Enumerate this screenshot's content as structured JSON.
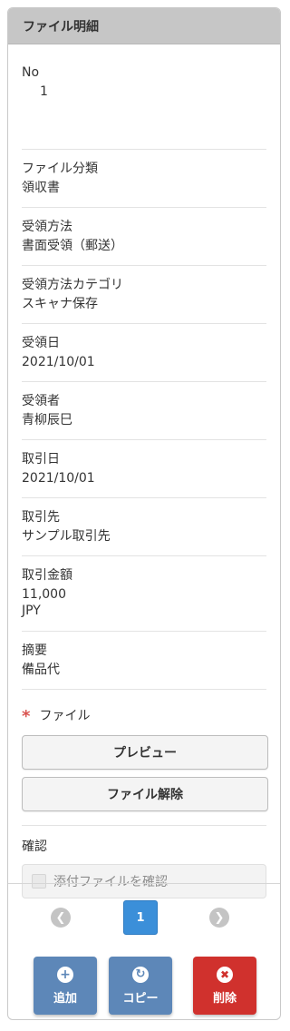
{
  "header": {
    "title": "ファイル明細"
  },
  "fields": {
    "no": {
      "label": "No",
      "value": "1"
    },
    "category": {
      "label": "ファイル分類",
      "value": "領収書"
    },
    "method": {
      "label": "受領方法",
      "value": "書面受領（郵送）"
    },
    "method_category": {
      "label": "受領方法カテゴリ",
      "value": "スキャナ保存"
    },
    "received_date": {
      "label": "受領日",
      "value": "2021/10/01"
    },
    "receiver": {
      "label": "受領者",
      "value": "青柳辰巳"
    },
    "transaction_date": {
      "label": "取引日",
      "value": "2021/10/01"
    },
    "partner": {
      "label": "取引先",
      "value": "サンプル取引先"
    },
    "amount": {
      "label": "取引金額",
      "value": "11,000",
      "currency": "JPY"
    },
    "summary": {
      "label": "摘要",
      "value": "備品代"
    }
  },
  "file": {
    "required_mark": "*",
    "label": "ファイル",
    "preview_label": "プレビュー",
    "remove_label": "ファイル解除"
  },
  "confirm": {
    "label": "確認",
    "checkbox_label": "添付ファイルを確認",
    "checked": false
  },
  "pager": {
    "current": "1"
  },
  "actions": {
    "add_label": "追加",
    "copy_label": "コピー",
    "delete_label": "削除"
  },
  "colors": {
    "header_bg": "#c6c6c6",
    "page_active": "#3b8fd9",
    "add_button": "#5d87b8",
    "copy_button": "#5d87b8",
    "delete_button": "#d0312d",
    "required": "#d9534f"
  }
}
